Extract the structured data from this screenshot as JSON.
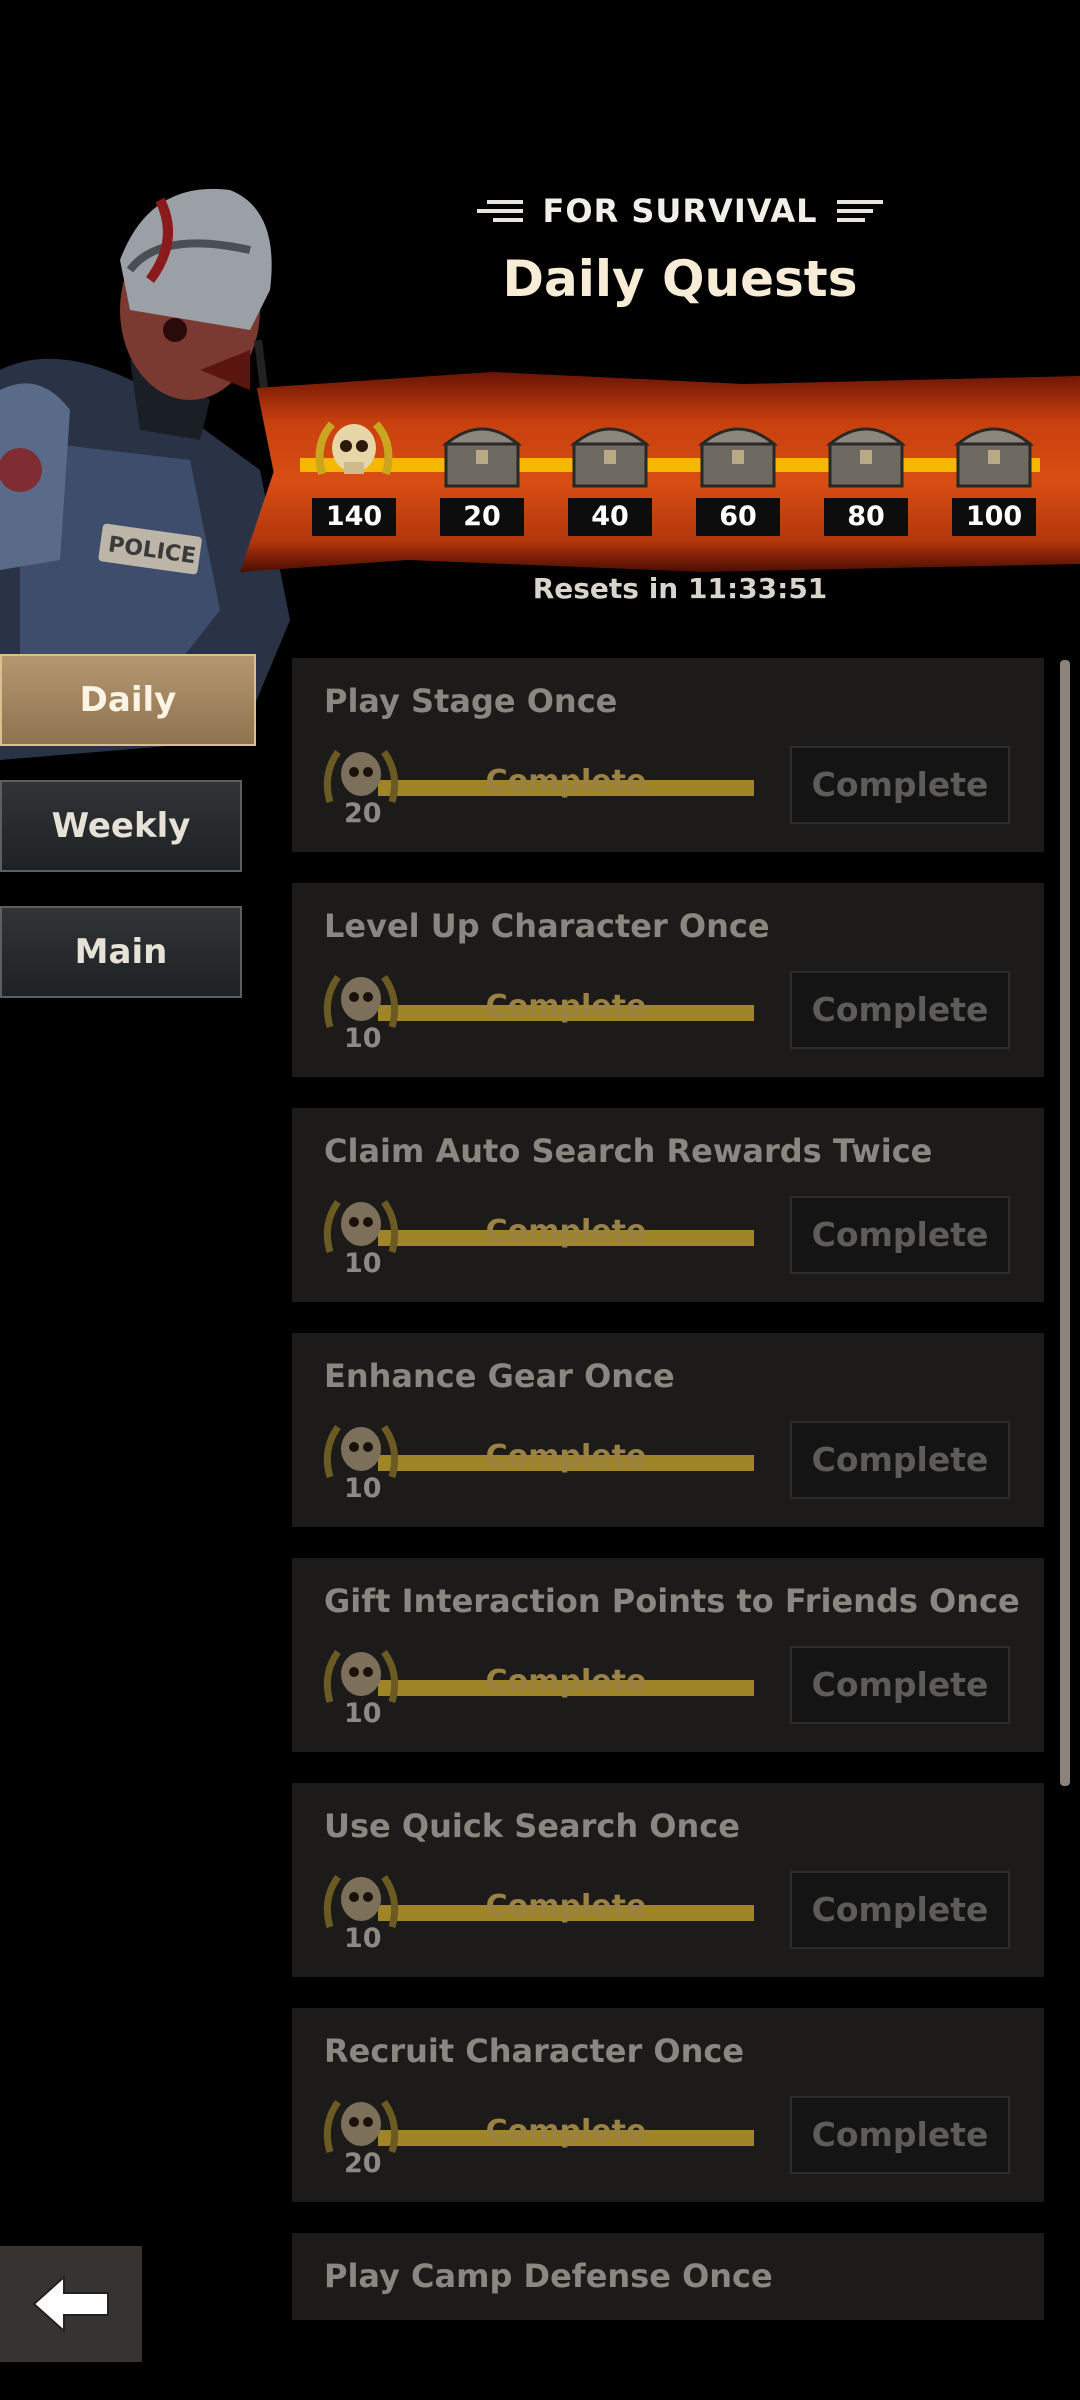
{
  "header": {
    "subtitle": "FOR SURVIVAL",
    "title": "Daily Quests"
  },
  "progress": {
    "current_points": "140",
    "milestones": [
      "20",
      "40",
      "60",
      "80",
      "100"
    ],
    "resets_text": "Resets in 11:33:51"
  },
  "tabs": [
    {
      "label": "Daily",
      "active": true
    },
    {
      "label": "Weekly",
      "active": false
    },
    {
      "label": "Main",
      "active": false
    }
  ],
  "quests": [
    {
      "title": "Play Stage Once",
      "points": "20",
      "progress_label": "Complete",
      "button": "Complete"
    },
    {
      "title": "Level Up Character Once",
      "points": "10",
      "progress_label": "Complete",
      "button": "Complete"
    },
    {
      "title": "Claim Auto Search Rewards Twice",
      "points": "10",
      "progress_label": "Complete",
      "button": "Complete"
    },
    {
      "title": "Enhance Gear Once",
      "points": "10",
      "progress_label": "Complete",
      "button": "Complete"
    },
    {
      "title": "Gift Interaction Points to Friends Once",
      "points": "10",
      "progress_label": "Complete",
      "button": "Complete"
    },
    {
      "title": "Use Quick Search Once",
      "points": "10",
      "progress_label": "Complete",
      "button": "Complete"
    },
    {
      "title": "Recruit Character Once",
      "points": "20",
      "progress_label": "Complete",
      "button": "Complete"
    },
    {
      "title": "Play Camp Defense Once",
      "points": "",
      "progress_label": "",
      "button": ""
    }
  ],
  "icons": {
    "back": "back-arrow-icon",
    "points": "skull-laurel-icon",
    "milestone": "chest-icon"
  },
  "colors": {
    "banner": "#d84e14",
    "track": "#f5b800",
    "card": "#1c1b1a"
  }
}
